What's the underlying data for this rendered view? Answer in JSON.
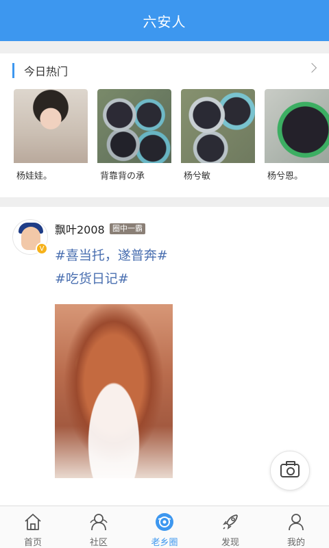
{
  "header": {
    "title": "六安人"
  },
  "hot": {
    "title": "今日热门",
    "items": [
      {
        "name": "杨娃娃。"
      },
      {
        "name": "背靠背の承"
      },
      {
        "name": "杨兮敏"
      },
      {
        "name": "杨兮恩。"
      }
    ]
  },
  "post": {
    "username": "飘叶2008",
    "level": "圈中一霸",
    "avatar_badge": "V",
    "tags": [
      "#喜当托，遂普奔#",
      "#吃货日记#"
    ]
  },
  "tabs": [
    {
      "label": "首页",
      "icon": "home-icon"
    },
    {
      "label": "社区",
      "icon": "community-icon"
    },
    {
      "label": "老乡圈",
      "icon": "hometown-circle-icon",
      "active": true
    },
    {
      "label": "发现",
      "icon": "rocket-icon"
    },
    {
      "label": "我的",
      "icon": "profile-icon"
    }
  ],
  "colors": {
    "accent": "#3d97ef",
    "tag": "#4a6fb0"
  }
}
